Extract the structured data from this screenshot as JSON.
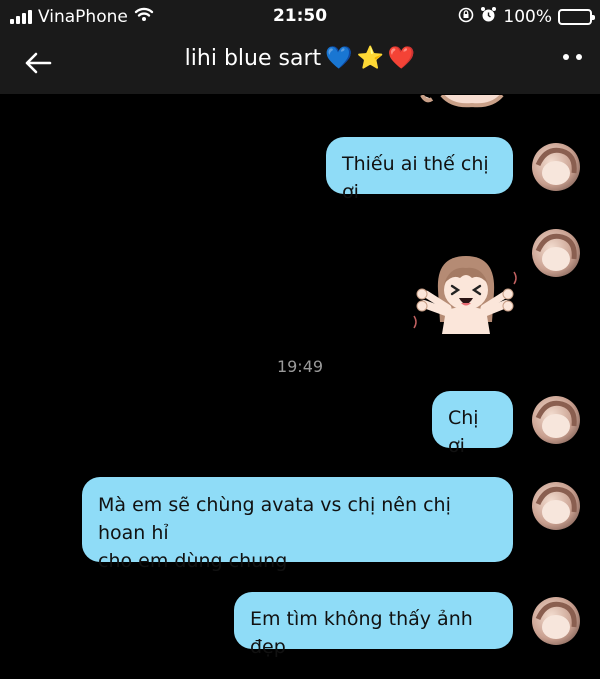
{
  "status_bar": {
    "carrier": "VinaPhone",
    "time": "21:50",
    "battery": "100%"
  },
  "header": {
    "title": "lihi blue sart",
    "title_emojis": [
      "💙",
      "⭐",
      "❤️"
    ]
  },
  "messages": {
    "m1": "Thiếu ai thế chị ơi",
    "timestamp": "19:49",
    "m2": "Chị ơi",
    "m3_line1": "Mà em sẽ chùng avata vs chị nên chị hoan hỉ",
    "m3_line2": "cho em dùng chung",
    "m4": "Em tìm không thấy ảnh đẹp"
  },
  "colors": {
    "bubble": "#8fdcf7",
    "background": "#000000",
    "header": "#1a1a1a"
  }
}
